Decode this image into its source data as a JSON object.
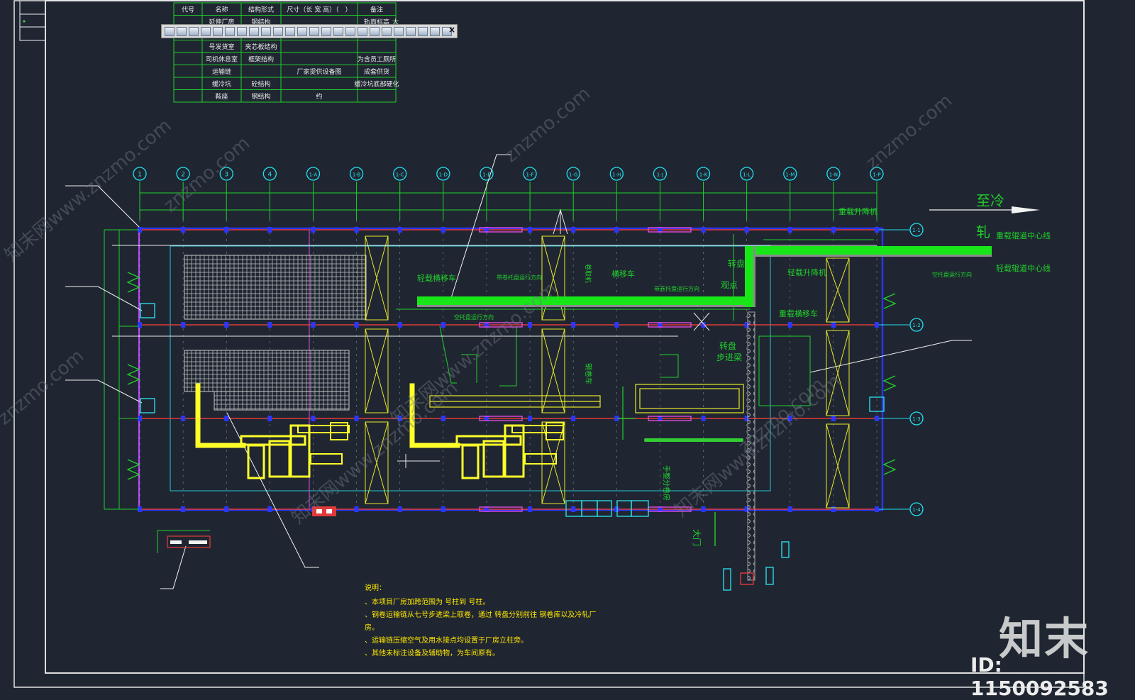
{
  "table": {
    "headers": [
      "代号",
      "名称",
      "结构形式",
      "尺寸（长 宽 高）（　）",
      "备注"
    ],
    "rows": [
      [
        "",
        "延伸厂房",
        "钢结构",
        "",
        "轨面标高"
      ],
      [
        "",
        "",
        "",
        "",
        ""
      ],
      [
        "",
        "号发货室",
        "夹芯板结构",
        "",
        ""
      ],
      [
        "",
        "司机休息室",
        "框架结构",
        "",
        "为含员工厕所"
      ],
      [
        "",
        "运输链",
        "",
        "厂家提供设备图",
        "成套供货"
      ],
      [
        "",
        "缓冷坑",
        "砼结构",
        "",
        "缓冷坑底部硬化"
      ],
      [
        "",
        "鞍座",
        "钢结构",
        "约",
        ""
      ]
    ],
    "extra_mark": "大"
  },
  "toolbar": {
    "button_count": 24,
    "close_label": "×"
  },
  "axes": {
    "labels": [
      "1",
      "2",
      "3",
      "4",
      "1-A",
      "1-B",
      "1-C",
      "1-D",
      "1-E",
      "1-F",
      "1-G",
      "1-H",
      "1-J",
      "1-K",
      "1-L",
      "1-M",
      "1-N",
      "1-P"
    ],
    "row_labels": [
      "1-1",
      "1-2",
      "1-3",
      "1-4"
    ]
  },
  "labels": {
    "to_cold_rolling": "至冷",
    "rolling": "轧",
    "heavy_lift": "重载升降机",
    "heavy_track": "重载辊道中心线",
    "light_track": "轻载辊道中心线",
    "light_lift": "轻载升降机",
    "light_transfer": "轻载横移车",
    "heavy_transfer": "重载横移车",
    "transfer_car": "横移车",
    "coil_tray_dir": "带卷托盘运行方向",
    "coil_tray_dir_2": "带卷托盘运行方向",
    "empty_tray_dir": "空托盘运行方向",
    "empty_tray_dir_2": "空托盘运行方向",
    "turntable": "转盘",
    "turntable_2": "转盘",
    "zero_point": "观点",
    "stepper": "步进梁",
    "coil_car": "钢卷车",
    "roller_label": "卷取机",
    "manual_sampling": "手整分卷房",
    "gate": "大门"
  },
  "notes": {
    "title": "说明：",
    "lines": [
      "、本项目厂房加跨范围为  号柱到      号柱。",
      "、钢卷运输链从七号步进梁上取卷，通过    转盘分别前往    钢卷库以及冷轧厂",
      "房。",
      "、运输链压缩空气及用水接点均设置于厂房立柱旁。",
      "、其他未标注设备及辅助物，为车间原有。"
    ]
  },
  "watermark": {
    "logo": "知末",
    "id": "ID: 1150092583",
    "diag": "znzmo.com",
    "diag_cn": "知末网www.znzmo.com"
  },
  "colors": {
    "background": "#1f2631",
    "frame": "#ffffff",
    "axis": "#22e0f0",
    "dimension": "#21d02c",
    "column_red": "#e23a3a",
    "column_blue": "#2b36ff",
    "equipment": "#ffff2a",
    "track": "#00ff00",
    "magenta": "#e24ae2",
    "note": "#ffe600"
  }
}
